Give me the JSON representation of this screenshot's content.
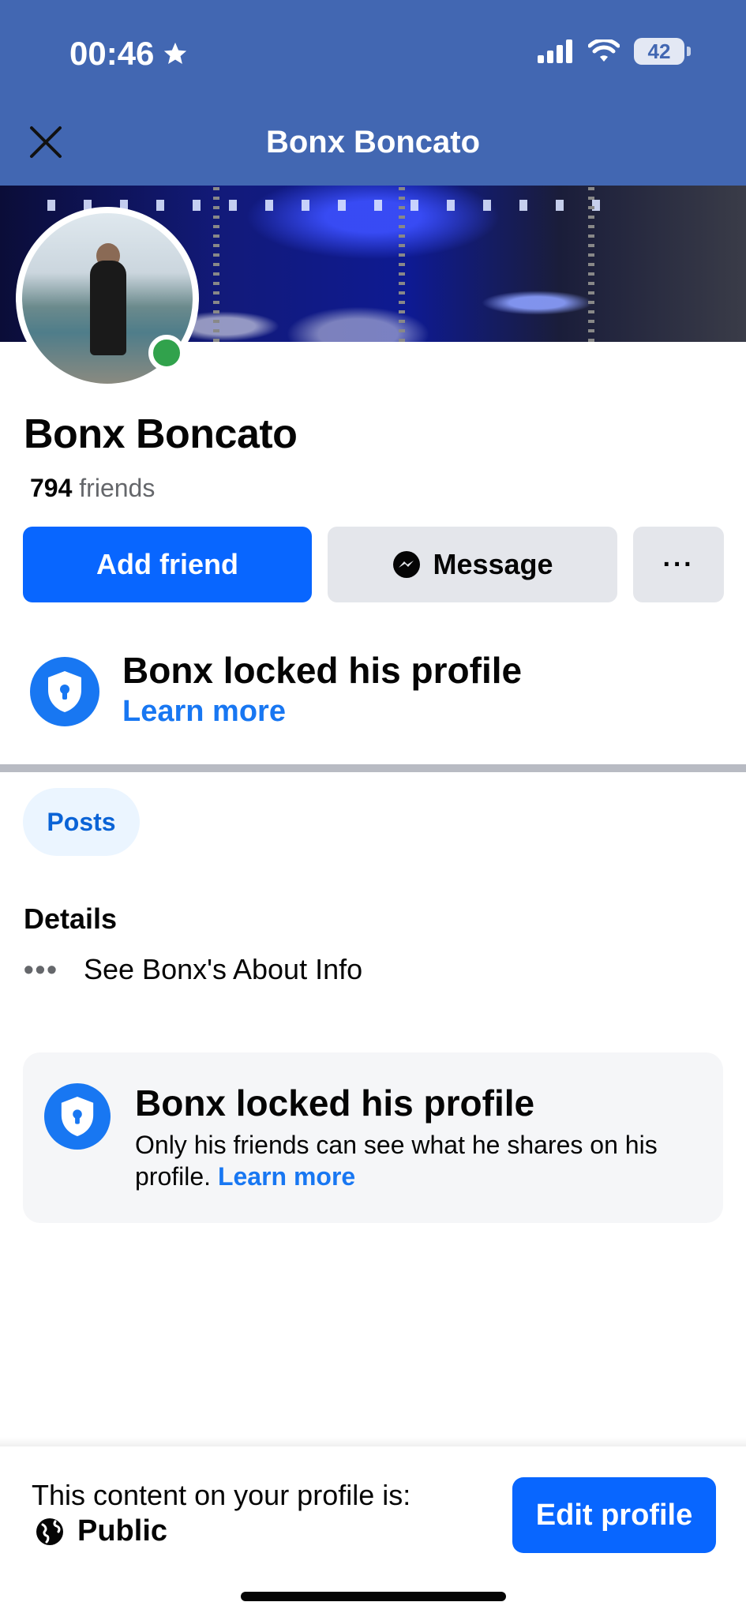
{
  "status_bar": {
    "time": "00:46",
    "battery": "42",
    "icons": [
      "star-icon",
      "signal-icon",
      "wifi-icon",
      "battery-icon"
    ]
  },
  "header": {
    "title": "Bonx Boncato",
    "close_icon": "close-icon",
    "background_color": "#4267b2"
  },
  "profile": {
    "name": "Bonx Boncato",
    "friends_count": "794",
    "friends_label": "friends",
    "online_status_color": "#31a24c"
  },
  "actions": {
    "add_friend": "Add friend",
    "message": "Message",
    "more": "···"
  },
  "lock_notice": {
    "title": "Bonx locked his profile",
    "link": "Learn more"
  },
  "tabs": {
    "posts": "Posts"
  },
  "details": {
    "title": "Details",
    "about_row": "See Bonx's About Info"
  },
  "lock_card": {
    "title": "Bonx locked his profile",
    "body": "Only his friends can see what he shares on his profile.",
    "link": "Learn more"
  },
  "bottom_bar": {
    "label": "This content on your profile is:",
    "visibility": "Public",
    "edit_button": "Edit profile"
  },
  "colors": {
    "primary_blue": "#0866ff",
    "link_blue": "#1877f2",
    "secondary_button": "#e4e6eb"
  }
}
